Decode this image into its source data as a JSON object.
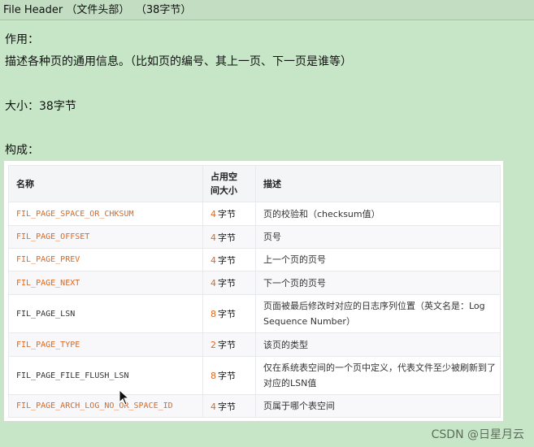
{
  "header": {
    "title": "File Header （文件头部）",
    "size": "（38字节）"
  },
  "content": {
    "usage_label": "作用：",
    "usage_text": "描述各种页的通用信息。（比如页的编号、其上一页、下一页是谁等）",
    "size_label": "大小：",
    "size_value": "38",
    "size_unit": "字节",
    "composition_label": "构成："
  },
  "table": {
    "headers": [
      "名称",
      "占用空间大小",
      "描述"
    ],
    "rows": [
      {
        "name": "FIL_PAGE_SPACE_OR_CHKSUM",
        "num": "4",
        "unit": "字节",
        "desc": "页的校验和（checksum值）"
      },
      {
        "name": "FIL_PAGE_OFFSET",
        "num": "4",
        "unit": "字节",
        "desc": "页号"
      },
      {
        "name": "FIL_PAGE_PREV",
        "num": "4",
        "unit": "字节",
        "desc": "上一个页的页号"
      },
      {
        "name": "FIL_PAGE_NEXT",
        "num": "4",
        "unit": "字节",
        "desc": "下一个页的页号"
      },
      {
        "name": "FIL_PAGE_LSN",
        "num": "8",
        "unit": "字节",
        "desc": "页面被最后修改时对应的日志序列位置（英文名是：Log Sequence Number）"
      },
      {
        "name": "FIL_PAGE_TYPE",
        "num": "2",
        "unit": "字节",
        "desc": "该页的类型"
      },
      {
        "name": "FIL_PAGE_FILE_FLUSH_LSN",
        "num": "8",
        "unit": "字节",
        "desc": "仅在系统表空间的一个页中定义，代表文件至少被刷新到了对应的LSN值"
      },
      {
        "name": "FIL_PAGE_ARCH_LOG_NO_OR_SPACE_ID",
        "num": "4",
        "unit": "字节",
        "desc": "页属于哪个表空间"
      }
    ]
  },
  "watermark": "CSDN @日星月云",
  "colors": {
    "background": "#c7e6c7",
    "code_accent": "#e3661b"
  },
  "icons": [
    "mouse-cursor-icon"
  ]
}
